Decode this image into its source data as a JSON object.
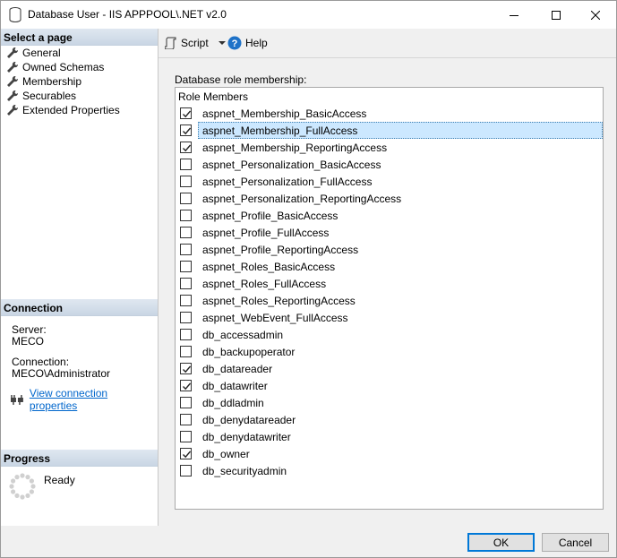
{
  "window": {
    "title": "Database User - IIS APPPOOL\\.NET v2.0"
  },
  "left_pane": {
    "select_page_header": "Select a page",
    "pages": [
      {
        "label": "General"
      },
      {
        "label": "Owned Schemas"
      },
      {
        "label": "Membership"
      },
      {
        "label": "Securables"
      },
      {
        "label": "Extended Properties"
      }
    ],
    "connection_header": "Connection",
    "server_label": "Server:",
    "server_value": "MECO",
    "connection_label": "Connection:",
    "connection_value": "MECO\\Administrator",
    "view_connection_link": "View connection properties",
    "progress_header": "Progress",
    "progress_status": "Ready"
  },
  "toolbar": {
    "script_label": "Script",
    "help_label": "Help"
  },
  "main": {
    "caption": "Database role membership:",
    "column_header": "Role Members",
    "roles": [
      {
        "name": "aspnet_Membership_BasicAccess",
        "checked": true,
        "selected": false
      },
      {
        "name": "aspnet_Membership_FullAccess",
        "checked": true,
        "selected": true
      },
      {
        "name": "aspnet_Membership_ReportingAccess",
        "checked": true,
        "selected": false
      },
      {
        "name": "aspnet_Personalization_BasicAccess",
        "checked": false,
        "selected": false
      },
      {
        "name": "aspnet_Personalization_FullAccess",
        "checked": false,
        "selected": false
      },
      {
        "name": "aspnet_Personalization_ReportingAccess",
        "checked": false,
        "selected": false
      },
      {
        "name": "aspnet_Profile_BasicAccess",
        "checked": false,
        "selected": false
      },
      {
        "name": "aspnet_Profile_FullAccess",
        "checked": false,
        "selected": false
      },
      {
        "name": "aspnet_Profile_ReportingAccess",
        "checked": false,
        "selected": false
      },
      {
        "name": "aspnet_Roles_BasicAccess",
        "checked": false,
        "selected": false
      },
      {
        "name": "aspnet_Roles_FullAccess",
        "checked": false,
        "selected": false
      },
      {
        "name": "aspnet_Roles_ReportingAccess",
        "checked": false,
        "selected": false
      },
      {
        "name": "aspnet_WebEvent_FullAccess",
        "checked": false,
        "selected": false
      },
      {
        "name": "db_accessadmin",
        "checked": false,
        "selected": false
      },
      {
        "name": "db_backupoperator",
        "checked": false,
        "selected": false
      },
      {
        "name": "db_datareader",
        "checked": true,
        "selected": false
      },
      {
        "name": "db_datawriter",
        "checked": true,
        "selected": false
      },
      {
        "name": "db_ddladmin",
        "checked": false,
        "selected": false
      },
      {
        "name": "db_denydatareader",
        "checked": false,
        "selected": false
      },
      {
        "name": "db_denydatawriter",
        "checked": false,
        "selected": false
      },
      {
        "name": "db_owner",
        "checked": true,
        "selected": false
      },
      {
        "name": "db_securityadmin",
        "checked": false,
        "selected": false
      }
    ]
  },
  "buttons": {
    "ok_label": "OK",
    "cancel_label": "Cancel"
  },
  "icons": {
    "title": "database-icon",
    "page": "wrench-icon",
    "script": "script-icon",
    "help": "help-icon",
    "connection": "connection-plug-icon",
    "progress": "progress-spinner-icon"
  },
  "colors": {
    "selection": "#cce8ff",
    "link": "#0066cc",
    "help_icon": "#1e72c8",
    "default_button_border": "#0078d7"
  }
}
